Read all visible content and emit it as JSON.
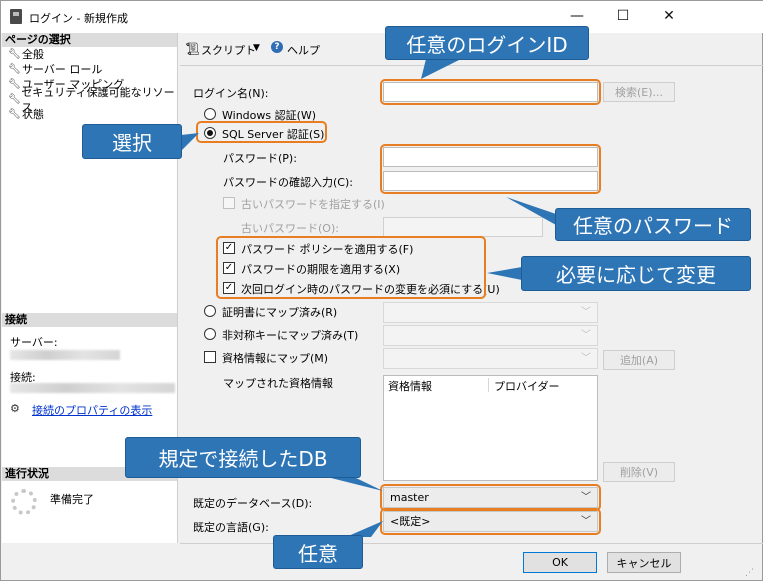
{
  "window": {
    "title": "ログイン - 新規作成",
    "minimize": "—",
    "maximize": "☐",
    "close": "✕"
  },
  "sidebar": {
    "pages_header": "ページの選択",
    "pages": [
      {
        "label": "全般",
        "icon": "wrench-icon"
      },
      {
        "label": "サーバー ロール",
        "icon": "wrench-icon"
      },
      {
        "label": "ユーザー マッピング",
        "icon": "wrench-icon"
      },
      {
        "label": "セキュリティ保護可能なリソース",
        "icon": "wrench-icon"
      },
      {
        "label": "状態",
        "icon": "wrench-icon"
      }
    ],
    "connection_header": "接続",
    "server_label": "サーバー:",
    "connection_label": "接続:",
    "connection_link": "接続のプロパティの表示",
    "progress_header": "進行状況",
    "progress_status": "準備完了"
  },
  "toolbar": {
    "script_label": "スクリプト",
    "help_label": "ヘルプ"
  },
  "form": {
    "login_name_label": "ログイン名(N):",
    "search_button": "検索(E)...",
    "windows_auth": "Windows 認証(W)",
    "sql_auth": "SQL Server 認証(S)",
    "password_label": "パスワード(P):",
    "confirm_password_label": "パスワードの確認入力(C):",
    "specify_old_password": "古いパスワードを指定する(I)",
    "old_password_label": "古いパスワード(O):",
    "enforce_policy": "パスワード ポリシーを適用する(F)",
    "enforce_expiration": "パスワードの期限を適用する(X)",
    "must_change": "次回ログイン時のパスワードの変更を必須にする(U)",
    "map_certificate": "証明書にマップ済み(R)",
    "map_asymmetric_key": "非対称キーにマップ済み(T)",
    "map_credential": "資格情報にマップ(M)",
    "add_button": "追加(A)",
    "mapped_credentials_label": "マップされた資格情報",
    "credentials_table": {
      "columns": [
        "資格情報",
        "プロバイダー"
      ]
    },
    "remove_button": "削除(V)",
    "default_db_label": "既定のデータベース(D):",
    "default_db_value": "master",
    "default_lang_label": "既定の言語(G):",
    "default_lang_value": "<既定>",
    "ok_button": "OK",
    "cancel_button": "キャンセル"
  },
  "annotations": {
    "login_id": "任意のログインID",
    "select": "選択",
    "password": "任意のパスワード",
    "as_needed": "必要に応じて変更",
    "default_db": "規定で接続したDB",
    "optional": "任意"
  },
  "colors": {
    "callout": "#2e75b6",
    "highlight": "#e87e22"
  }
}
